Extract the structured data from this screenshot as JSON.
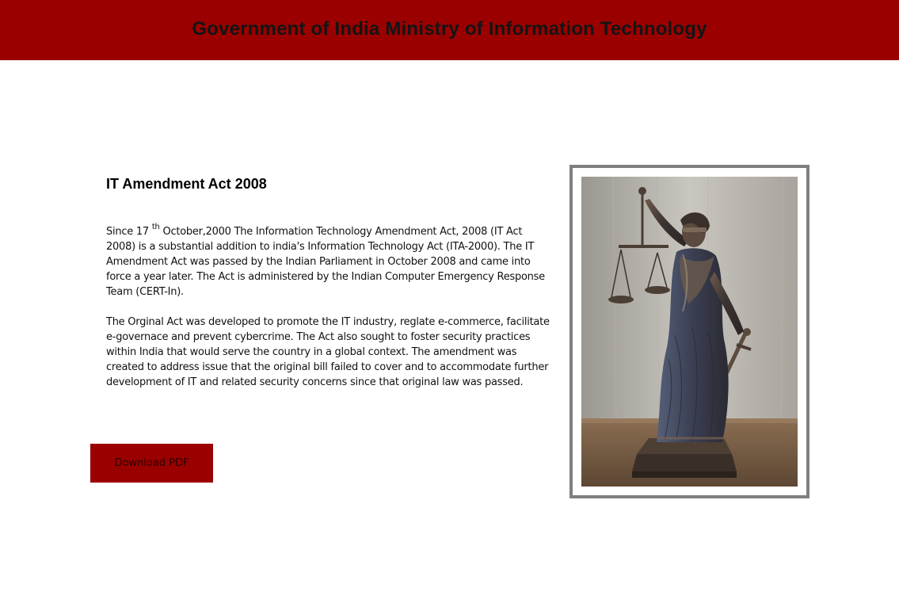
{
  "header": {
    "title": "Government of India Ministry of Information Technology"
  },
  "article": {
    "title": "IT Amendment Act 2008",
    "para1_pre": "Since 17 ",
    "para1_sup": "th",
    "para1_post": " October,2000 The Information Technology Amendment Act, 2008 (IT Act 2008) is a substantial addition to india's Information Technology Act (ITA-2000). The IT Amendment Act was passed by the Indian Parliament in October 2008 and came into force a year later. The Act is administered by the Indian Computer Emergency Response Team (CERT-In).",
    "para2": "The Orginal Act was developed to promote the IT industry, reglate e-commerce, facilitate e-governace and prevent cybercrime. The Act also sought to foster security practices within India that would serve the country in a global context. The amendment was created to address issue that the original bill failed to cover and to accommodate further development of IT and related security concerns since that original law was passed."
  },
  "actions": {
    "download_label": "Download PDF"
  },
  "image": {
    "subject": "lady-justice-statue-photo"
  },
  "colors": {
    "brand": "#9b0000",
    "frame": "#7f7f7f"
  }
}
